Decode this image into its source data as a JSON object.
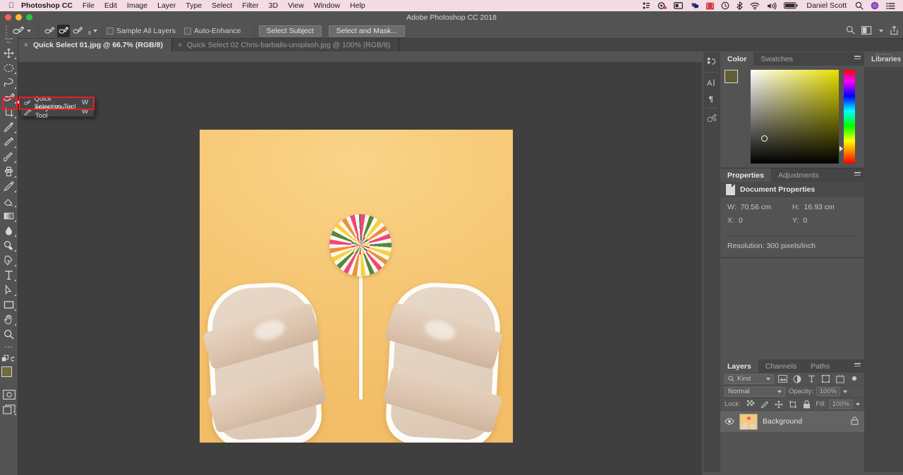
{
  "mac_menubar": {
    "apple_icon": "apple-icon",
    "app_name": "Photoshop CC",
    "menus": [
      "File",
      "Edit",
      "Image",
      "Layer",
      "Type",
      "Select",
      "Filter",
      "3D",
      "View",
      "Window",
      "Help"
    ],
    "status_items": [
      {
        "icon": "dropbox-icon"
      },
      {
        "icon": "creative-cloud-icon"
      },
      {
        "icon": "display-icon"
      },
      {
        "icon": "shield-icon"
      },
      {
        "icon": "video-icon"
      },
      {
        "icon": "time-machine-icon"
      },
      {
        "icon": "bluetooth-icon"
      },
      {
        "icon": "wifi-icon"
      },
      {
        "icon": "volume-icon"
      },
      {
        "icon": "battery-icon"
      }
    ],
    "user_name": "Daniel Scott",
    "search_icon": "spotlight-search-icon",
    "siri_icon": "siri-icon",
    "control_center_icon": "notification-center-icon"
  },
  "window": {
    "title": "Adobe Photoshop CC 2018",
    "traffic_lights": [
      {
        "name": "close-button",
        "color": "#ff5f57"
      },
      {
        "name": "minimize-button",
        "color": "#febc2e"
      },
      {
        "name": "maximize-button",
        "color": "#28c840"
      }
    ]
  },
  "options_bar": {
    "tool_icon": "quick-selection-tool-icon",
    "modes": [
      {
        "name": "new-selection-mode",
        "selected": false
      },
      {
        "name": "add-to-selection-mode",
        "selected": true
      },
      {
        "name": "subtract-from-selection-mode",
        "selected": false
      }
    ],
    "brush_size": "8",
    "sample_all_layers": {
      "label": "Sample All Layers",
      "checked": false
    },
    "auto_enhance": {
      "label": "Auto-Enhance",
      "checked": false
    },
    "select_subject": "Select Subject",
    "select_and_mask": "Select and Mask...",
    "right_icons": [
      {
        "name": "search-icon"
      },
      {
        "name": "workspace-switcher-icon"
      },
      {
        "name": "share-icon"
      }
    ]
  },
  "tabs": [
    {
      "label": "Quick Select 01.jpg @ 66.7% (RGB/8)",
      "active": true
    },
    {
      "label": "Quick Select 02 Chris-barbalis-unsplash.jpg @ 100% (RGB/8)",
      "active": false
    }
  ],
  "toolbar": {
    "tools": [
      {
        "name": "move-tool-icon",
        "glyph": "move"
      },
      {
        "name": "elliptical-marquee-tool-icon",
        "glyph": "ellipse"
      },
      {
        "name": "lasso-tool-icon",
        "glyph": "lasso"
      },
      {
        "name": "quick-selection-tool-icon",
        "glyph": "quickselect",
        "active": true
      },
      {
        "name": "crop-tool-icon",
        "glyph": "crop"
      },
      {
        "name": "eyedropper-tool-icon",
        "glyph": "eyedropper"
      },
      {
        "name": "spot-healing-brush-tool-icon",
        "glyph": "healing"
      },
      {
        "name": "brush-tool-icon",
        "glyph": "brush"
      },
      {
        "name": "clone-stamp-tool-icon",
        "glyph": "stamp"
      },
      {
        "name": "history-brush-tool-icon",
        "glyph": "historybrush"
      },
      {
        "name": "eraser-tool-icon",
        "glyph": "eraser"
      },
      {
        "name": "gradient-tool-icon",
        "glyph": "gradient"
      },
      {
        "name": "blur-tool-icon",
        "glyph": "blur"
      },
      {
        "name": "dodge-tool-icon",
        "glyph": "dodge"
      },
      {
        "name": "pen-tool-icon",
        "glyph": "pen"
      },
      {
        "name": "type-tool-icon",
        "glyph": "type"
      },
      {
        "name": "path-selection-tool-icon",
        "glyph": "pathselect"
      },
      {
        "name": "rectangle-tool-icon",
        "glyph": "rectangle"
      },
      {
        "name": "hand-tool-icon",
        "glyph": "hand"
      },
      {
        "name": "zoom-tool-icon",
        "glyph": "zoom"
      }
    ],
    "more_tools_icon": "more-tools-icon",
    "quick-mask-icon": "quick-mask-icon",
    "screen-mode-icon": "screen-mode-icon",
    "foreground_color": "#6e6e3d",
    "background_color": "#c9c9a0"
  },
  "flyout": {
    "items": [
      {
        "label": "Quick Selection Tool",
        "shortcut": "W",
        "selected": true
      },
      {
        "label": "Magic Wand Tool",
        "shortcut": "W",
        "selected": false
      }
    ],
    "highlight_color": "#ee1c25"
  },
  "color_panel": {
    "tabs": [
      {
        "label": "Color",
        "active": true
      },
      {
        "label": "Swatches",
        "active": false
      }
    ],
    "foreground_color": "#5f5f33",
    "background_color": "#c8c8c8"
  },
  "properties_panel": {
    "tabs": [
      {
        "label": "Properties",
        "active": true
      },
      {
        "label": "Adjustments",
        "active": false
      }
    ],
    "header": "Document Properties",
    "header_icon": "document-icon",
    "fields": [
      [
        {
          "label": "W:",
          "value": "70.56 cm"
        },
        {
          "label": "H:",
          "value": "16.93 cm"
        }
      ],
      [
        {
          "label": "X:",
          "value": "0"
        },
        {
          "label": "Y:",
          "value": "0"
        }
      ]
    ],
    "resolution": "Resolution: 300 pixels/inch"
  },
  "layers_panel": {
    "tabs": [
      {
        "label": "Layers",
        "active": true
      },
      {
        "label": "Channels",
        "active": false
      },
      {
        "label": "Paths",
        "active": false
      }
    ],
    "filter_label": "Kind",
    "filter_icons": [
      {
        "name": "filter-pixel-layers-icon"
      },
      {
        "name": "filter-adjustment-layers-icon"
      },
      {
        "name": "filter-type-layers-icon"
      },
      {
        "name": "filter-shape-layers-icon"
      },
      {
        "name": "filter-smart-object-icon"
      },
      {
        "name": "filter-toggle-icon"
      }
    ],
    "blend_mode": "Normal",
    "opacity_label": "Opacity:",
    "opacity_value": "100%",
    "lock_label": "Lock:",
    "lock_icons": [
      {
        "name": "lock-transparent-pixels-icon"
      },
      {
        "name": "lock-image-pixels-icon"
      },
      {
        "name": "lock-position-icon"
      },
      {
        "name": "lock-artboard-nesting-icon"
      },
      {
        "name": "lock-all-icon"
      }
    ],
    "fill_label": "Fill:",
    "fill_value": "100%",
    "layers": [
      {
        "name": "Background",
        "visible": true,
        "locked": true,
        "visibility_icon": "eye-icon",
        "lock_icon": "lock-icon"
      }
    ]
  },
  "dock_strip": {
    "items": [
      {
        "name": "history-panel-icon"
      },
      {
        "name": "character-panel-icon"
      },
      {
        "name": "paragraph-panel-icon"
      },
      {
        "name": "brush-settings-panel-icon"
      }
    ]
  },
  "libraries_panel": {
    "label": "Libraries",
    "icon": "libraries-icon"
  },
  "canvas": {
    "background_color": "#f6c978",
    "objects": [
      {
        "name": "swirl-lollipop",
        "colors": [
          "#f0457e",
          "#4e8b3c",
          "#f5d13c",
          "#e8913f",
          "#fff6ea"
        ]
      },
      {
        "name": "lollipop-stick",
        "color": "#fdfdfb"
      },
      {
        "name": "left-sandal",
        "color": "#e2d0bd"
      },
      {
        "name": "right-sandal",
        "color": "#e2d0bd"
      }
    ]
  }
}
